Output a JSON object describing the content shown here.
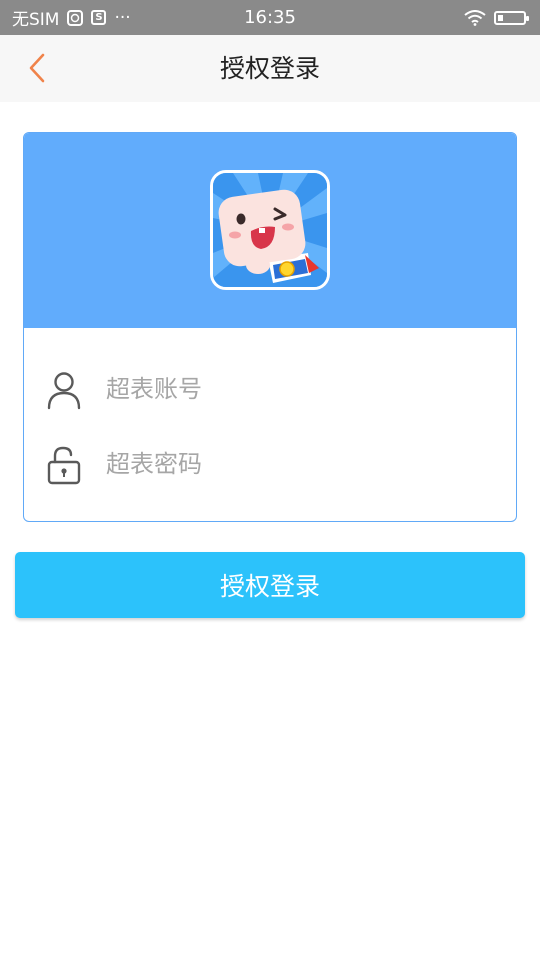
{
  "status_bar": {
    "carrier": "无SIM",
    "time": "16:35",
    "more": "···",
    "icons": [
      "globe-icon",
      "s-box-icon",
      "wifi-icon",
      "battery-icon"
    ]
  },
  "header": {
    "title": "授权登录",
    "back_icon": "chevron-left-icon"
  },
  "login_card": {
    "account_placeholder": "超表账号",
    "password_placeholder": "超表密码",
    "account_value": "",
    "password_value": ""
  },
  "login_button": {
    "label": "授权登录"
  },
  "colors": {
    "accent": "#2cc2fb",
    "banner": "#61acfc",
    "back_arrow": "#f0834a",
    "status_bar": "#8a8a8a"
  }
}
